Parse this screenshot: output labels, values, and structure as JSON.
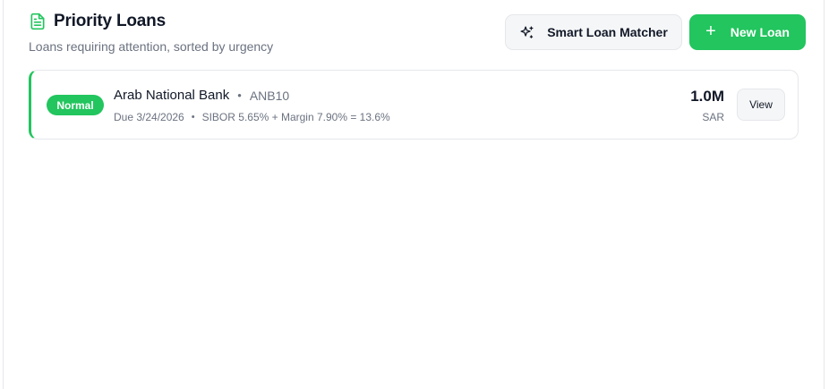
{
  "header": {
    "title": "Priority Loans",
    "subtitle": "Loans requiring attention, sorted by urgency",
    "title_icon": "document-icon"
  },
  "actions": {
    "matcher_label": "Smart Loan Matcher",
    "matcher_icon": "sparkles-icon",
    "new_loan_label": "New Loan",
    "new_loan_icon": "plus-icon"
  },
  "loans": [
    {
      "status": "Normal",
      "bank": "Arab National Bank",
      "code": "ANB10",
      "due": "Due 3/24/2026",
      "rate": "SIBOR 5.65% + Margin 7.90% = 13.6%",
      "amount": "1.0M",
      "currency": "SAR",
      "view_label": "View"
    }
  ],
  "colors": {
    "accent": "#22c55e",
    "text_primary": "#111827",
    "text_muted": "#6b7280",
    "border": "#e5e7eb"
  }
}
